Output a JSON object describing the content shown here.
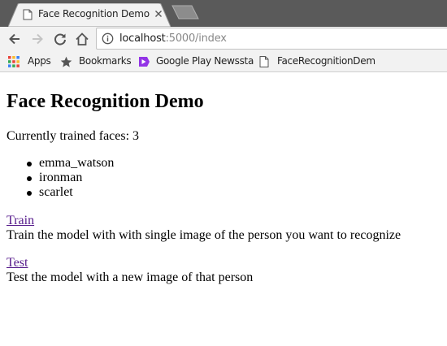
{
  "browser": {
    "tab": {
      "title": "Face Recognition Demo"
    },
    "address_bar": {
      "host": "localhost",
      "path": ":5000/index"
    },
    "bookmarks": [
      {
        "label": "Apps",
        "icon": "apps-grid-icon"
      },
      {
        "label": "Bookmarks",
        "icon": "star-icon"
      },
      {
        "label": "Google Play Newssta",
        "icon": "play-newsstand-icon"
      },
      {
        "label": "FaceRecognitionDem",
        "icon": "page-icon"
      }
    ]
  },
  "page": {
    "title": "Face Recognition Demo",
    "trained_text": "Currently trained faces: 3",
    "faces": [
      "emma_watson",
      "ironman",
      "scarlet"
    ],
    "train": {
      "link_label": "Train",
      "description": "Train the model with with single image of the person you want to recognize"
    },
    "test": {
      "link_label": "Test",
      "description": "Test the model with a new image of that person"
    }
  },
  "colors": {
    "tabstrip": "#5a5a5a",
    "toolbar": "#f2f2f2",
    "visited_link": "#551a8b"
  }
}
